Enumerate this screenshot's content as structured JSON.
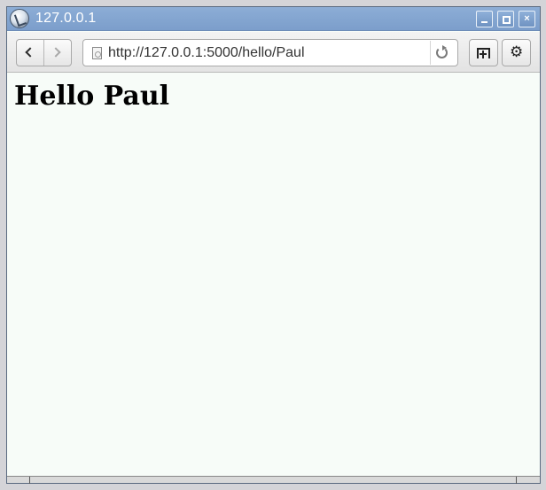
{
  "window": {
    "title": "127.0.0.1",
    "controls": {
      "minimize": "minimize",
      "maximize": "maximize",
      "close": "close"
    }
  },
  "toolbar": {
    "url": "http://127.0.0.1:5000/hello/Paul",
    "icons": [
      "back-icon",
      "forward-icon",
      "page-icon",
      "reload-icon",
      "new-tab-icon",
      "gear-icon"
    ]
  },
  "page": {
    "heading": "Hello Paul"
  },
  "colors": {
    "titlebar": "#7c9ecb",
    "content_background": "#f7fcf8"
  }
}
